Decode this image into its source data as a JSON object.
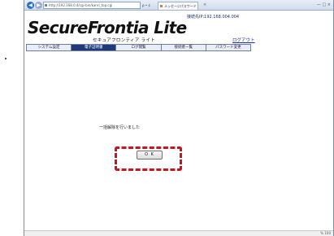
{
  "browser": {
    "address": "http://192.168.0.4/cgi-bin/kanri_top.cgi",
    "address_tools": "ρ • ¢",
    "tab_title": "メッセージパスワード",
    "tab_close": "×",
    "window_controls": "— □ ×",
    "zoom": "% 100"
  },
  "header": {
    "connection_info": "接続先IP:192.168.004.004",
    "logo": "SecureFrontia Lite",
    "subtitle": "セキュアフロンティア ライト",
    "logout": "ログアウト"
  },
  "menu": {
    "items": [
      {
        "label": "システム設定"
      },
      {
        "label": "電子証明書"
      },
      {
        "label": "ログ閲覧"
      },
      {
        "label": "接続者一覧"
      },
      {
        "label": "パスワード変更"
      }
    ],
    "active_index": 1
  },
  "main": {
    "message": "一括解除を行いました",
    "ok_label": "O K"
  },
  "colors": {
    "menu_active": "#1f3a7a",
    "highlight": "#c8141d",
    "logo": "#111111"
  }
}
